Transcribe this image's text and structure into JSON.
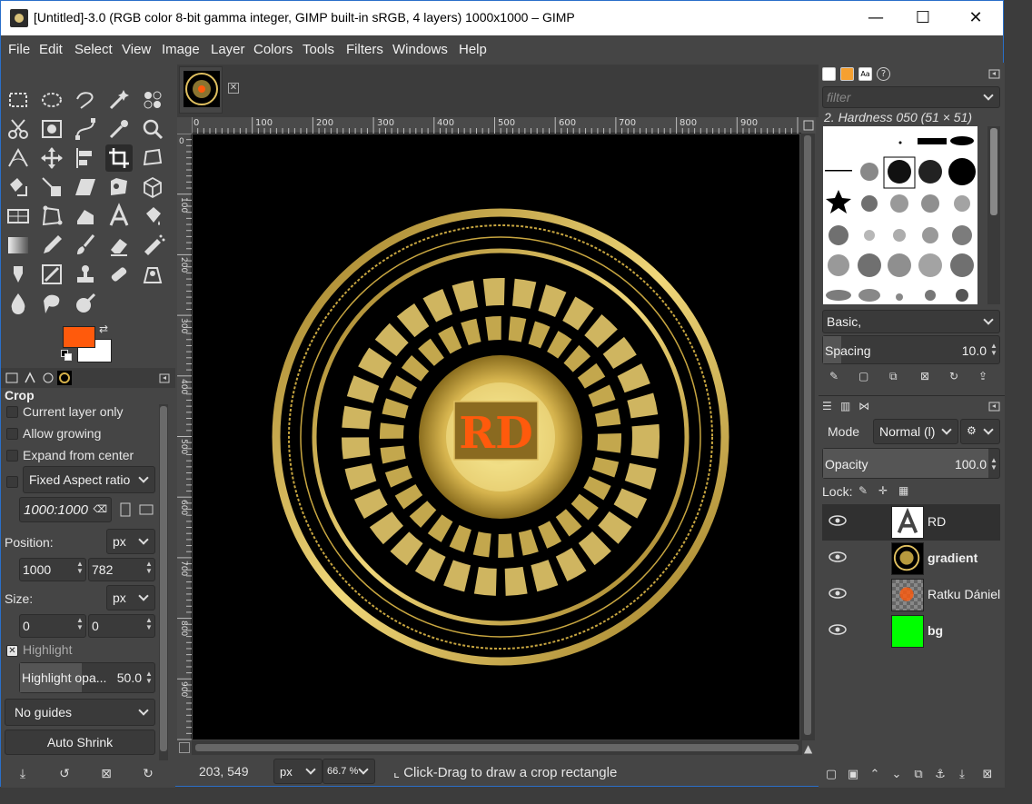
{
  "window": {
    "title": "[Untitled]-3.0 (RGB color 8-bit gamma integer, GIMP built-in sRGB, 4 layers) 1000x1000 – GIMP",
    "minimize": "—",
    "maximize": "☐",
    "close": "✕"
  },
  "menu": [
    "File",
    "Edit",
    "Select",
    "View",
    "Image",
    "Layer",
    "Colors",
    "Tools",
    "Filters",
    "Windows",
    "Help"
  ],
  "colors": {
    "foreground": "#ff5a0c",
    "background": "#ffffff",
    "accent_gold": "#e0c060"
  },
  "tool_options": {
    "title": "Crop",
    "current_layer_only": "Current layer only",
    "allow_growing": "Allow growing",
    "expand_from_center": "Expand from center",
    "fixed_aspect": "Fixed  Aspect ratio",
    "aspect_value": "1000:1000",
    "position_label": "Position:",
    "position_unit": "px",
    "position_x": "1000",
    "position_y": "782",
    "size_label": "Size:",
    "size_unit": "px",
    "size_w": "0",
    "size_h": "0",
    "highlight": "Highlight",
    "highlight_opacity_label": "Highlight opa...",
    "highlight_opacity_value": "50.0",
    "guides": "No guides",
    "auto_shrink": "Auto Shrink"
  },
  "rulers": {
    "h_ticks": [
      "0",
      "100",
      "200",
      "300",
      "400",
      "500",
      "600",
      "700",
      "800",
      "900"
    ],
    "v_ticks": [
      "0",
      "100",
      "200",
      "300",
      "400",
      "500",
      "600",
      "700",
      "800",
      "900"
    ]
  },
  "status": {
    "coords": "203, 549",
    "unit": "px",
    "zoom": "66.7 %",
    "message": "Click-Drag to draw a crop rectangle"
  },
  "brushes": {
    "filter_placeholder": "filter",
    "selected": "2. Hardness 050 (51 × 51)",
    "preset": "Basic,",
    "spacing_label": "Spacing",
    "spacing_value": "10.0"
  },
  "layers_panel": {
    "mode_label": "Mode",
    "mode_value": "Normal (l)",
    "opacity_label": "Opacity",
    "opacity_value": "100.0",
    "lock_label": "Lock:",
    "layers": [
      {
        "name": "RD",
        "type": "text"
      },
      {
        "name": "gradient",
        "type": "image"
      },
      {
        "name": "Ratku Dániel",
        "type": "text-transparent"
      },
      {
        "name": "bg",
        "type": "fill"
      }
    ]
  },
  "canvas_text": {
    "monogram": "RD",
    "ring_text": "Ratku Dániel"
  }
}
